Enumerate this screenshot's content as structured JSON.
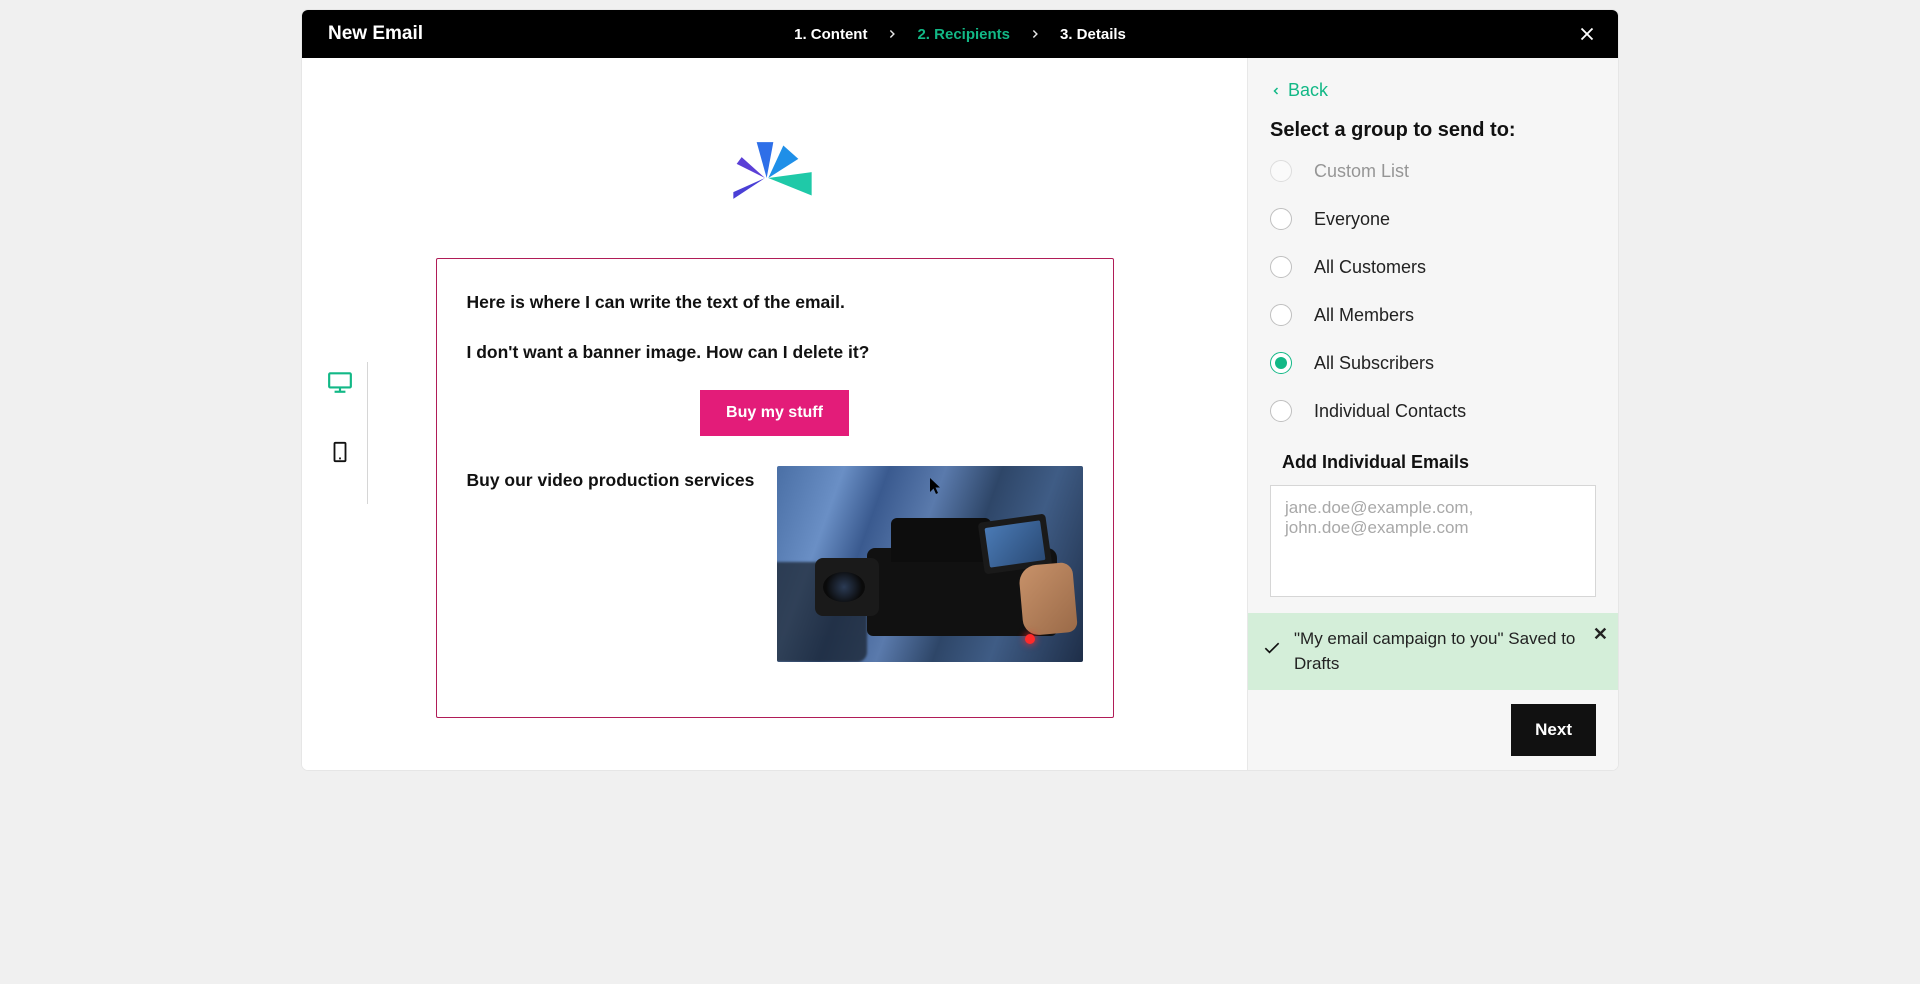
{
  "header": {
    "title": "New Email",
    "steps": [
      {
        "label": "1. Content",
        "active": false
      },
      {
        "label": "2. Recipients",
        "active": true
      },
      {
        "label": "3. Details",
        "active": false
      }
    ]
  },
  "preview": {
    "paragraph1": "Here is where I can write the text of the email.",
    "paragraph2": "I don't want a banner image. How can I delete it?",
    "cta_label": "Buy my stuff",
    "media_text": "Buy our video production services"
  },
  "sidebar": {
    "back_label": "Back",
    "title": "Select a group to send to:",
    "options": [
      {
        "label": "Custom List",
        "selected": false,
        "disabled": true
      },
      {
        "label": "Everyone",
        "selected": false,
        "disabled": false
      },
      {
        "label": "All Customers",
        "selected": false,
        "disabled": false
      },
      {
        "label": "All Members",
        "selected": false,
        "disabled": false
      },
      {
        "label": "All Subscribers",
        "selected": true,
        "disabled": false
      },
      {
        "label": "Individual Contacts",
        "selected": false,
        "disabled": false
      }
    ],
    "add_emails_label": "Add Individual Emails",
    "emails_placeholder": "jane.doe@example.com, john.doe@example.com",
    "toast_message": "\"My email campaign to you\" Saved to Drafts",
    "next_label": "Next"
  }
}
